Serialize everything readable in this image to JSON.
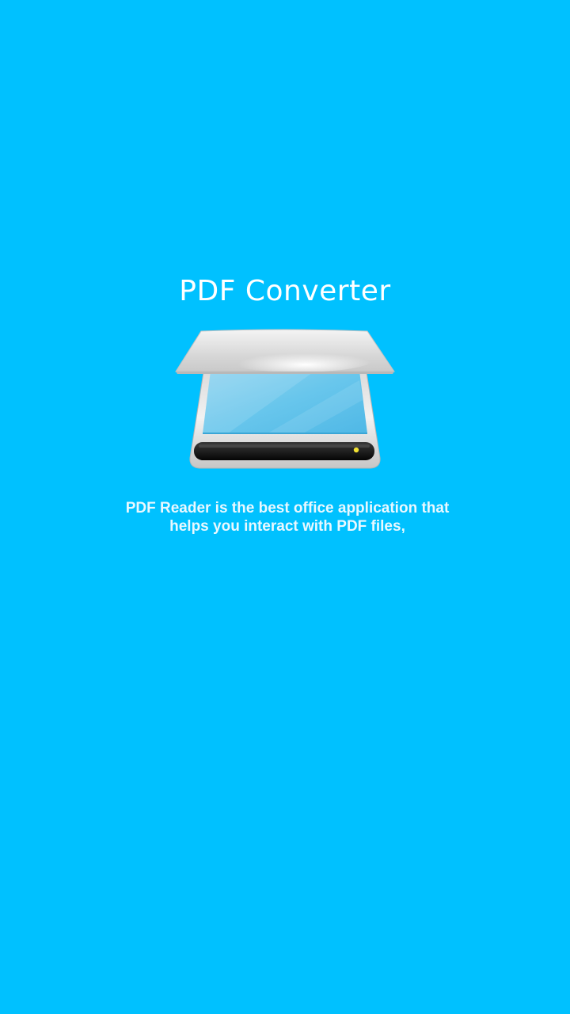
{
  "splash": {
    "title": "PDF Converter",
    "tagline": "PDF Reader is the best office application that helps you interact with PDF files,",
    "illustration_icon": "scanner-icon"
  },
  "colors": {
    "background": "#00c1ff",
    "text": "#ffffff"
  }
}
